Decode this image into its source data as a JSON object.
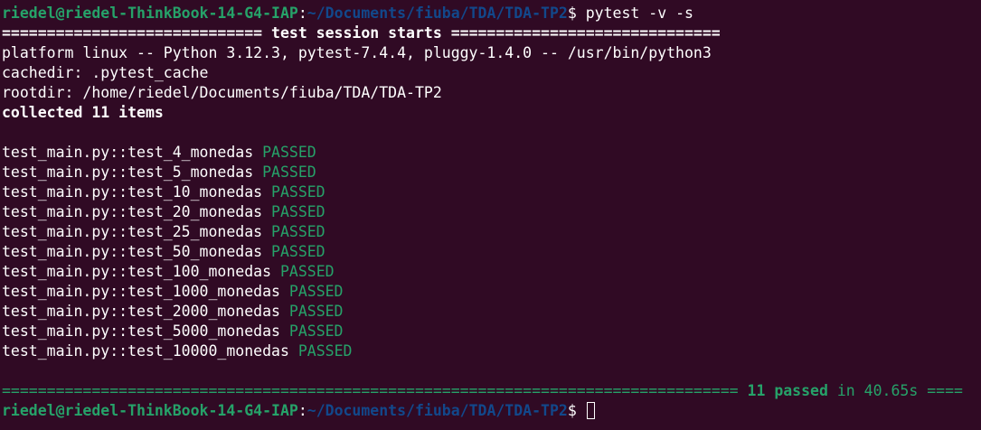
{
  "prompt": {
    "user_host": "riedel@riedel-ThinkBook-14-G4-IAP",
    "colon": ":",
    "path": "~/Documents/fiuba/TDA/TDA-TP2",
    "dollar": "$ ",
    "command": "pytest -v -s"
  },
  "session": {
    "header_left": "============================= ",
    "header_title": "test session starts",
    "header_right": " ==============================",
    "platform": "platform linux -- Python 3.12.3, pytest-7.4.4, pluggy-1.4.0 -- /usr/bin/python3",
    "cachedir": "cachedir: .pytest_cache",
    "rootdir": "rootdir: /home/riedel/Documents/fiuba/TDA/TDA-TP2",
    "collected": "collected 11 items"
  },
  "tests": [
    {
      "name": "test_main.py::test_4_monedas ",
      "status": "PASSED"
    },
    {
      "name": "test_main.py::test_5_monedas ",
      "status": "PASSED"
    },
    {
      "name": "test_main.py::test_10_monedas ",
      "status": "PASSED"
    },
    {
      "name": "test_main.py::test_20_monedas ",
      "status": "PASSED"
    },
    {
      "name": "test_main.py::test_25_monedas ",
      "status": "PASSED"
    },
    {
      "name": "test_main.py::test_50_monedas ",
      "status": "PASSED"
    },
    {
      "name": "test_main.py::test_100_monedas ",
      "status": "PASSED"
    },
    {
      "name": "test_main.py::test_1000_monedas ",
      "status": "PASSED"
    },
    {
      "name": "test_main.py::test_2000_monedas ",
      "status": "PASSED"
    },
    {
      "name": "test_main.py::test_5000_monedas ",
      "status": "PASSED"
    },
    {
      "name": "test_main.py::test_10000_monedas ",
      "status": "PASSED"
    }
  ],
  "summary": {
    "sep_left": "================================================================================== ",
    "passed": "11 passed",
    "duration": " in 40.65s ",
    "sep_right": "===="
  },
  "colors": {
    "background": "#300a24",
    "prompt_user": "#26a269",
    "prompt_path": "#12488b",
    "passed": "#26a269",
    "text": "#ffffff"
  }
}
